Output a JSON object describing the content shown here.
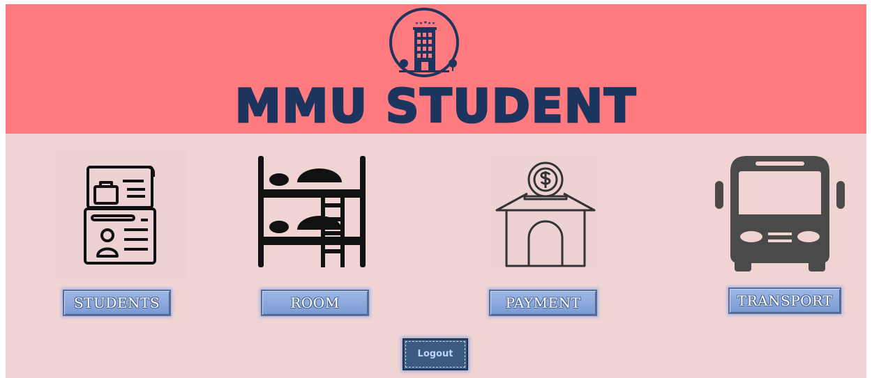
{
  "header": {
    "brand": "MMU STUDENT",
    "logo_icon": "hotel-building-icon",
    "bg_color": "#ff7b80",
    "brand_color": "#1d355e"
  },
  "nav": [
    {
      "label": "STUDENTS",
      "icon": "student-id-card-icon"
    },
    {
      "label": "ROOM",
      "icon": "bunk-bed-icon"
    },
    {
      "label": "PAYMENT",
      "icon": "payment-house-icon"
    },
    {
      "label": "TRANSPORT",
      "icon": "bus-icon"
    }
  ],
  "logout": {
    "label": "Logout"
  }
}
